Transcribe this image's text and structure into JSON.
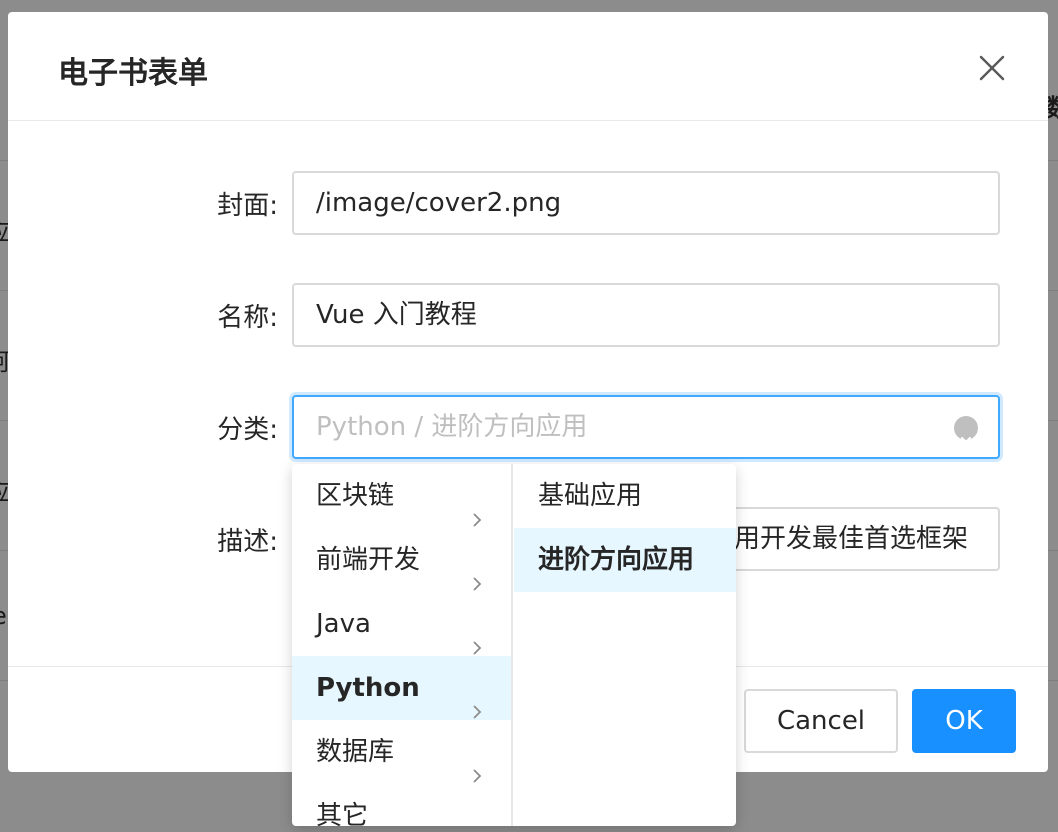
{
  "background": {
    "edge_fragments": [
      "数",
      "应",
      "阿",
      "应",
      "e"
    ]
  },
  "modal": {
    "title": "电子书表单",
    "close_icon": "close-icon",
    "fields": {
      "cover": {
        "label": "封面:",
        "value": "/image/cover2.png"
      },
      "name": {
        "label": "名称:",
        "value": "Vue 入门教程"
      },
      "category": {
        "label": "分类:",
        "placeholder": "Python / 进阶方向应用",
        "clear_icon": "clear-circle-icon"
      },
      "description": {
        "label": "描述:",
        "value_visible_tail": "用开发最佳首选框架"
      }
    },
    "footer": {
      "cancel_label": "Cancel",
      "ok_label": "OK"
    }
  },
  "cascader": {
    "level1": [
      {
        "label": "区块链",
        "active": false
      },
      {
        "label": "前端开发",
        "active": false
      },
      {
        "label": "Java",
        "active": false
      },
      {
        "label": "Python",
        "active": true
      },
      {
        "label": "数据库",
        "active": false
      },
      {
        "label": "其它",
        "active": false
      }
    ],
    "level2": [
      {
        "label": "基础应用",
        "active": false
      },
      {
        "label": "进阶方向应用",
        "active": true
      }
    ],
    "arrow_icon": "chevron-right-icon"
  },
  "colors": {
    "primary": "#1890ff",
    "active_bg": "#e6f7ff",
    "focus_border": "#40a9ff",
    "placeholder": "#bfbfbf"
  }
}
